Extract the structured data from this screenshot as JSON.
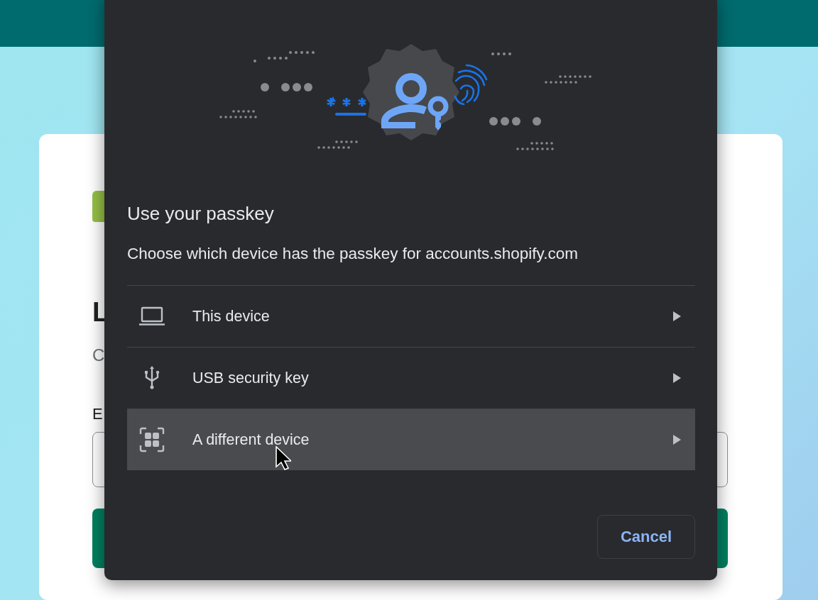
{
  "background_page": {
    "heading": "L",
    "subheading": "C",
    "field_label": "E"
  },
  "dialog": {
    "title": "Use your passkey",
    "subtitle": "Choose which device has the passkey for accounts.shopify.com",
    "options": [
      {
        "kind": "laptop",
        "label": "This device",
        "hovered": false
      },
      {
        "kind": "usb",
        "label": "USB security key",
        "hovered": false
      },
      {
        "kind": "grid",
        "label": "A different device",
        "hovered": true
      }
    ],
    "cancel_button": "Cancel"
  }
}
